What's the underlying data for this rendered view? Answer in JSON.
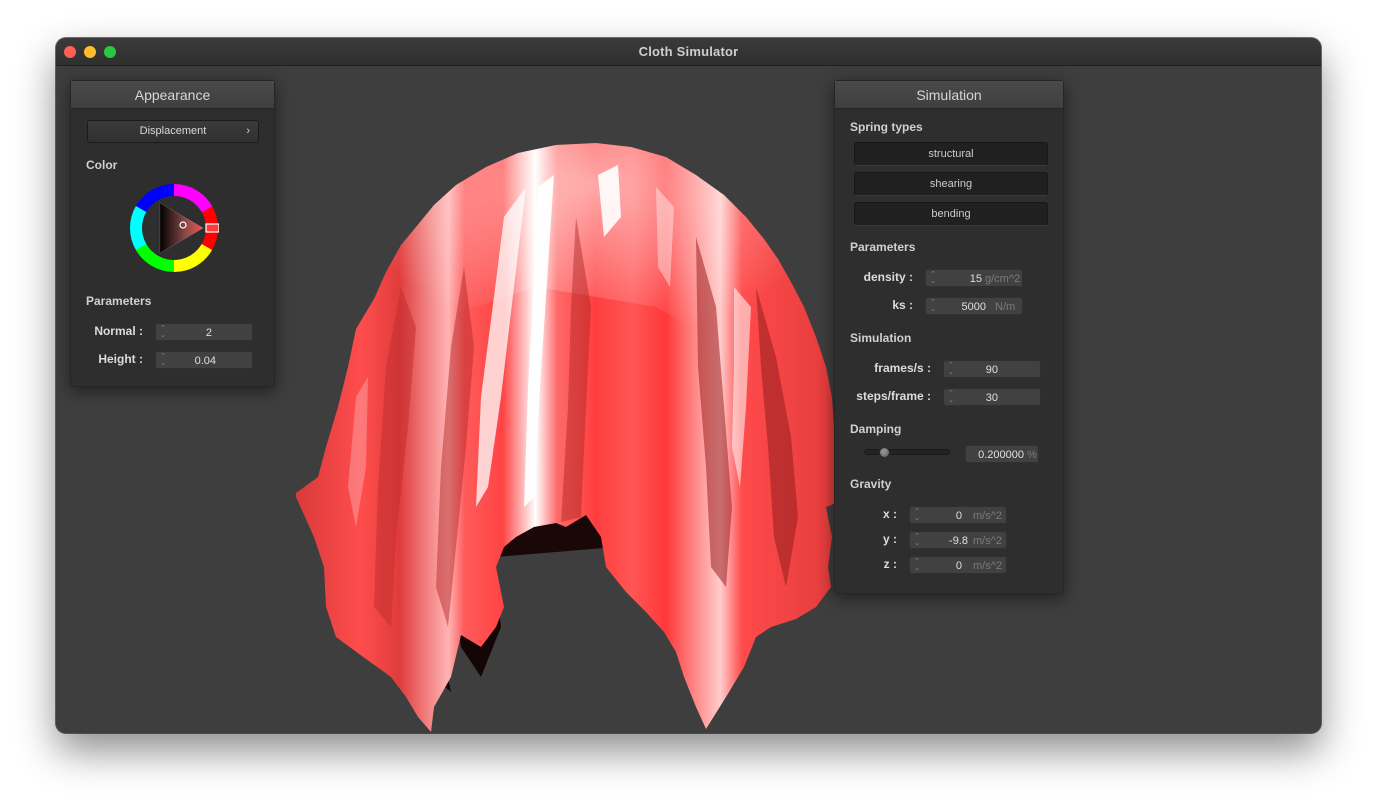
{
  "window": {
    "title": "Cloth Simulator"
  },
  "appearance": {
    "header": "Appearance",
    "shader_button": "Displacement",
    "color_label": "Color",
    "selected_color": "#ff4d4d",
    "parameters_label": "Parameters",
    "normal": {
      "label": "Normal :",
      "value": "2"
    },
    "height": {
      "label": "Height :",
      "value": "0.04"
    }
  },
  "simulation": {
    "header": "Simulation",
    "spring_types_label": "Spring types",
    "spring_buttons": [
      "structural",
      "shearing",
      "bending"
    ],
    "parameters_label": "Parameters",
    "density": {
      "label": "density :",
      "value": "15",
      "unit": "g/cm^2"
    },
    "ks": {
      "label": "ks :",
      "value": "5000",
      "unit": "N/m"
    },
    "simulation_label": "Simulation",
    "frames_per_s": {
      "label": "frames/s :",
      "value": "90"
    },
    "steps_per_frame": {
      "label": "steps/frame :",
      "value": "30"
    },
    "damping_label": "Damping",
    "damping": {
      "value": "0.200000",
      "unit": "%",
      "fraction": 0.2
    },
    "gravity_label": "Gravity",
    "gravity": {
      "x": {
        "label": "x :",
        "value": "0",
        "unit": "m/s^2"
      },
      "y": {
        "label": "y :",
        "value": "-9.8",
        "unit": "m/s^2"
      },
      "z": {
        "label": "z :",
        "value": "0",
        "unit": "m/s^2"
      }
    }
  },
  "scene": {
    "cloth_color": "#ff4d4d",
    "background": "#3e3e3e"
  }
}
